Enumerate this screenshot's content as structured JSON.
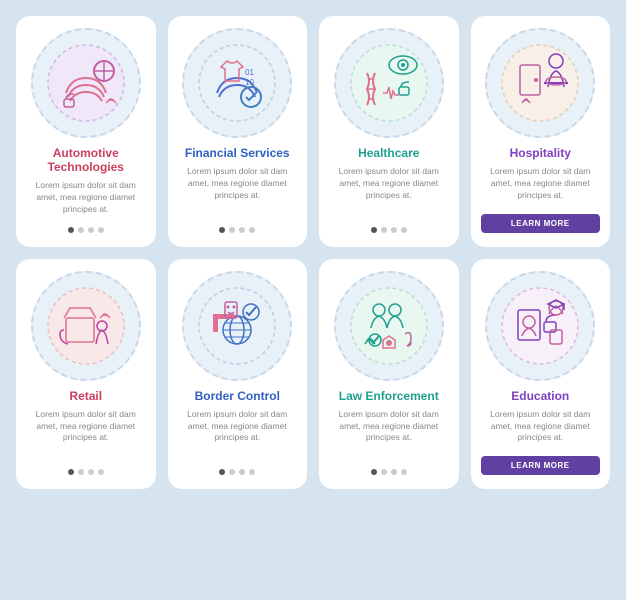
{
  "cards": [
    {
      "id": "automotive",
      "title": "Automotive Technologies",
      "title_color": "red",
      "body": "Lorem ipsum dolor sit dam amet, mea regione diamet principes at.",
      "dots": [
        true,
        false,
        false,
        false
      ],
      "show_button": false,
      "icon": "automotive"
    },
    {
      "id": "financial",
      "title": "Financial Services",
      "title_color": "blue",
      "body": "Lorem ipsum dolor sit dam amet, mea regione diamet principes at.",
      "dots": [
        false,
        false,
        false,
        false
      ],
      "show_button": false,
      "icon": "financial"
    },
    {
      "id": "healthcare",
      "title": "Healthcare",
      "title_color": "teal",
      "body": "Lorem ipsum dolor sit dam amet, mea regione diamet principes at.",
      "dots": [
        false,
        false,
        false,
        false
      ],
      "show_button": false,
      "icon": "healthcare"
    },
    {
      "id": "hospitality",
      "title": "Hospitality",
      "title_color": "purple",
      "body": "Lorem ipsum dolor sit dam amet, mea regione diamet principes at.",
      "dots": [],
      "show_button": true,
      "button_label": "LEARN MORE",
      "icon": "hospitality"
    },
    {
      "id": "retail",
      "title": "Retail",
      "title_color": "red",
      "body": "Lorem ipsum dolor sit dam amet, mea regione diamet principes at.",
      "dots": [
        true,
        false,
        false,
        false
      ],
      "show_button": false,
      "icon": "retail"
    },
    {
      "id": "border",
      "title": "Border Control",
      "title_color": "blue",
      "body": "Lorem ipsum dolor sit dam amet, mea regione diamet principes at.",
      "dots": [
        false,
        false,
        false,
        false
      ],
      "show_button": false,
      "icon": "border"
    },
    {
      "id": "law",
      "title": "Law Enforcement",
      "title_color": "teal",
      "body": "Lorem ipsum dolor sit dam amet, mea regione diamet principes at.",
      "dots": [
        false,
        false,
        false,
        false
      ],
      "show_button": false,
      "icon": "law"
    },
    {
      "id": "education",
      "title": "Education",
      "title_color": "purple",
      "body": "Lorem ipsum dolor sit dam amet, mea regione diamet principes at.",
      "dots": [],
      "show_button": true,
      "button_label": "LEARN MORE",
      "icon": "education"
    }
  ]
}
